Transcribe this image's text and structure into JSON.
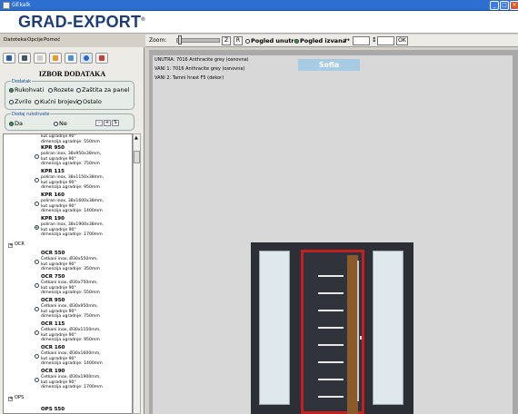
{
  "window": {
    "title": "GEkalk"
  },
  "logo": {
    "text": "GRAD-EXPORT",
    "reg": "®"
  },
  "menu": {
    "items": [
      "Datoteka",
      "Opcije",
      "Pomoć"
    ]
  },
  "left": {
    "heading": "IZBOR DODATAKA",
    "dodatak_group": {
      "title": "Dodatak",
      "options": [
        "Rukohvati",
        "Rozete",
        "Zaštita za panel",
        "Zvrilo",
        "Kućni brojevi",
        "Ostalo"
      ],
      "selected": "Rukohvati"
    },
    "dodaj_group": {
      "title": "Dodaj rukohvate",
      "yes": "Da",
      "no": "Ne",
      "minus": "-",
      "add": "+",
      "extra": "S"
    },
    "tree": {
      "top_partial": [
        "kut ugradnje 90°",
        "dimenzija ugradnje: 550mm"
      ],
      "kpr_items": [
        {
          "name": "KPR 950",
          "desc": [
            "poliran inox, 38x950x38mm,",
            "kut ugradnje 90°",
            "dimenzija ugradnje: 750mm"
          ]
        },
        {
          "name": "KPR 115",
          "desc": [
            "poliran inox, 38x1150x38mm,",
            "kut ugradnje 90°",
            "dimenzija ugradnje: 950mm"
          ]
        },
        {
          "name": "KPR 160",
          "desc": [
            "poliran inox, 38x1600x38mm,",
            "kut ugradnje 90°",
            "dimenzija ugradnje: 1400mm"
          ]
        },
        {
          "name": "KPR 190",
          "desc": [
            "poliran inox, 38x1900x38mm,",
            "kut ugradnje 90°",
            "dimenzija ugradnje: 1700mm"
          ]
        }
      ],
      "ocr_node": "OCR",
      "ocr_items": [
        {
          "name": "OCR 550",
          "desc": [
            "Četkani inox, Ø30x550mm,",
            "kut ugradnje 90°",
            "dimenzija ugradnje: 350mm"
          ]
        },
        {
          "name": "OCR 750",
          "desc": [
            "Četkani inox, Ø30x750mm,",
            "kut ugradnje 90°",
            "dimenzija ugradnje: 550mm"
          ]
        },
        {
          "name": "OCR 950",
          "desc": [
            "Četkani inox, Ø30x950mm,",
            "kut ugradnje 90°",
            "dimenzija ugradnje: 750mm"
          ]
        },
        {
          "name": "OCR 115",
          "desc": [
            "Četkani inox, Ø30x1150mm,",
            "kut ugradnje 90°",
            "dimenzija ugradnje: 950mm"
          ]
        },
        {
          "name": "OCR 160",
          "desc": [
            "Četkani inox, Ø30x1600mm,",
            "kut ugradnje 90°",
            "dimenzija ugradnje: 1400mm"
          ]
        },
        {
          "name": "OCR 190",
          "desc": [
            "Četkani inox, Ø30x1900mm,",
            "kut ugradnje 90°",
            "dimenzija ugradnje: 1700mm"
          ]
        }
      ],
      "ops_node": "OPS",
      "bottom_partial": "OPS 550"
    }
  },
  "toolbar": {
    "zoom_label": "Zoom:",
    "btn_z": "Z",
    "btn_r": "R",
    "view_inside": "Pogled unutra",
    "view_outside": "Pogled izvana",
    "arrow_h": "↔",
    "arrow_v": "↕",
    "ok": "OK"
  },
  "info": {
    "unutra": "UNUTRA:  7016 Anthracite grey (osnovna)",
    "vani1": "VANI 1:  7016 Anthracite grey (osnovna)",
    "vani2": "VANI 2:  Tamni hrast F5 (dekor)",
    "model": "Sofia"
  },
  "colors": {
    "brand": "#1f3d75",
    "door": "#30333b",
    "frame_accent": "#c42020",
    "wood": "#8b5a2b",
    "selected_radio": "#1c9c2a"
  }
}
